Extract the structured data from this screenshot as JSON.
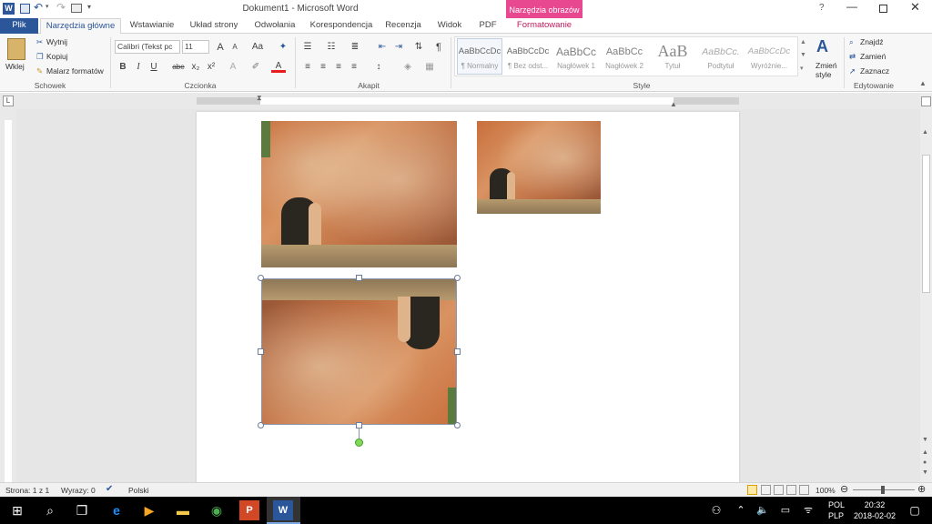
{
  "window": {
    "title": "Dokument1 - Microsoft Word",
    "context_tab_title": "Narzędzia obrazów"
  },
  "tabs": [
    {
      "label": "Plik"
    },
    {
      "label": "Narzędzia główne"
    },
    {
      "label": "Wstawianie"
    },
    {
      "label": "Układ strony"
    },
    {
      "label": "Odwołania"
    },
    {
      "label": "Korespondencja"
    },
    {
      "label": "Recenzja"
    },
    {
      "label": "Widok"
    },
    {
      "label": "PDF"
    },
    {
      "label": "Formatowanie"
    }
  ],
  "clipboard": {
    "paste": "Wklej",
    "cut": "Wytnij",
    "copy": "Kopiuj",
    "painter": "Malarz formatów",
    "group": "Schowek"
  },
  "font": {
    "name": "Calibri (Tekst pc",
    "size": "11",
    "group": "Czcionka",
    "grow": "A",
    "shrink": "A",
    "case": "Aa",
    "bold": "B",
    "italic": "I",
    "underline": "U",
    "strike": "abe",
    "sub": "x₂",
    "sup": "x²",
    "color": "A"
  },
  "paragraph": {
    "group": "Akapit",
    "pilcrow": "¶"
  },
  "styles": {
    "group": "Style",
    "items": [
      {
        "preview": "AaBbCcDc",
        "name": "¶ Normalny"
      },
      {
        "preview": "AaBbCcDc",
        "name": "¶ Bez odst..."
      },
      {
        "preview": "AaBbCc",
        "name": "Nagłówek 1"
      },
      {
        "preview": "AaBbCc",
        "name": "Nagłówek 2"
      },
      {
        "preview": "AaB",
        "name": "Tytuł"
      },
      {
        "preview": "AaBbCc.",
        "name": "Podtytuł"
      },
      {
        "preview": "AaBbCcDc",
        "name": "Wyróżnie..."
      }
    ],
    "change_line1": "Zmień",
    "change_line2": "style"
  },
  "editing": {
    "find": "Znajdź",
    "replace": "Zamień",
    "select": "Zaznacz",
    "group": "Edytowanie"
  },
  "statusbar": {
    "page": "Strona: 1 z 1",
    "words": "Wyrazy: 0",
    "language": "Polski",
    "zoom": "100%"
  },
  "taskbar": {
    "lang1": "POL",
    "lang2": "PLP",
    "time": "20:32",
    "date": "2018-02-02"
  },
  "colors": {
    "file_tab": "#2b579a",
    "context_tab": "#e8488f",
    "accent": "#2b579a"
  }
}
